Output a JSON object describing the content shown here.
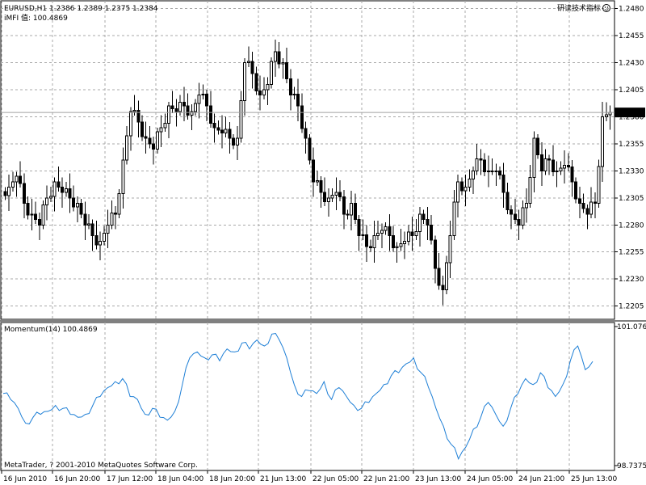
{
  "window": {
    "symbol_header": "EURUSD,H1  1.2386 1.2389 1.2375 1.2384",
    "mfi_label": "iMFI 值:  100.4869",
    "indicator_badge": "研读技术指标"
  },
  "footer": {
    "copyright": "MetaTrader, ? 2001-2010 MetaQuotes Software Corp."
  },
  "chart_data": [
    {
      "type": "candlestick",
      "title": "EURUSD,H1",
      "last_price_label": "1.2384",
      "ylim": [
        1.2195,
        1.2485
      ],
      "y_tick_labels": [
        "1.2480",
        "1.2455",
        "1.2430",
        "1.2405",
        "1.2380",
        "1.2355",
        "1.2330",
        "1.2305",
        "1.2280",
        "1.2255",
        "1.2230",
        "1.2205"
      ],
      "y_ticks": [
        1.248,
        1.2455,
        1.243,
        1.2405,
        1.238,
        1.2355,
        1.233,
        1.2305,
        1.228,
        1.2255,
        1.223,
        1.2205
      ],
      "x_tick_labels": [
        "16 Jun 2010",
        "16 Jun 20:00",
        "17 Jun 12:00",
        "18 Jun 04:00",
        "18 Jun 20:00",
        "21 Jun 13:00",
        "22 Jun 05:00",
        "22 Jun 21:00",
        "23 Jun 13:00",
        "24 Jun 05:00",
        "24 Jun 21:00",
        "25 Jun 13:00"
      ],
      "grid": true,
      "closes": [
        1.2315,
        1.2325,
        1.23,
        1.229,
        1.228,
        1.2305,
        1.232,
        1.231,
        1.2305,
        1.23,
        1.228,
        1.227,
        1.2265,
        1.228,
        1.229,
        1.234,
        1.2385,
        1.2375,
        1.236,
        1.235,
        1.237,
        1.239,
        1.2385,
        1.239,
        1.2385,
        1.24,
        1.239,
        1.237,
        1.2365,
        1.236,
        1.236,
        1.243,
        1.242,
        1.24,
        1.241,
        1.244,
        1.243,
        1.24,
        1.239,
        1.236,
        1.232,
        1.231,
        1.2305,
        1.231,
        1.229,
        1.23,
        1.227,
        1.226,
        1.227,
        1.2275,
        1.227,
        1.226,
        1.2265,
        1.227,
        1.229,
        1.228,
        1.224,
        1.222,
        1.227,
        1.232,
        1.2315,
        1.233,
        1.234,
        1.233,
        1.233,
        1.231,
        1.229,
        1.228,
        1.23,
        1.236,
        1.233,
        1.234,
        1.233,
        1.2335,
        1.232,
        1.23,
        1.229,
        1.23,
        1.238,
        1.2384
      ],
      "ohlc_note": "hourly candles"
    },
    {
      "type": "line",
      "title": "Momentum(14) 100.4869",
      "ylim": [
        98.7375,
        101.0763
      ],
      "y_tick_labels": [
        "101.0763",
        "98.7375"
      ],
      "series": [
        {
          "name": "Momentum(14)",
          "color": "#1e7fd6",
          "values": [
            99.95,
            99.85,
            99.7,
            99.45,
            99.55,
            99.6,
            99.65,
            99.75,
            99.7,
            99.6,
            99.55,
            99.6,
            99.75,
            99.9,
            100.05,
            100.15,
            100.2,
            99.9,
            99.85,
            99.6,
            99.7,
            99.55,
            99.5,
            99.65,
            100.1,
            100.55,
            100.65,
            100.55,
            100.6,
            100.5,
            100.7,
            100.65,
            100.8,
            100.7,
            100.85,
            100.75,
            100.95,
            100.85,
            100.55,
            100.1,
            99.9,
            100.0,
            99.95,
            100.15,
            99.85,
            100.05,
            99.9,
            99.75,
            99.7,
            99.8,
            99.95,
            100.1,
            100.25,
            100.3,
            100.45,
            100.55,
            100.3,
            100.05,
            99.7,
            99.4,
            99.1,
            98.85,
            99.05,
            99.35,
            99.55,
            99.8,
            99.6,
            99.4,
            99.7,
            99.95,
            100.2,
            100.1,
            100.3,
            100.05,
            99.9,
            100.1,
            100.5,
            100.75,
            100.35,
            100.49
          ],
          "last_value": "100.4869"
        }
      ]
    }
  ]
}
